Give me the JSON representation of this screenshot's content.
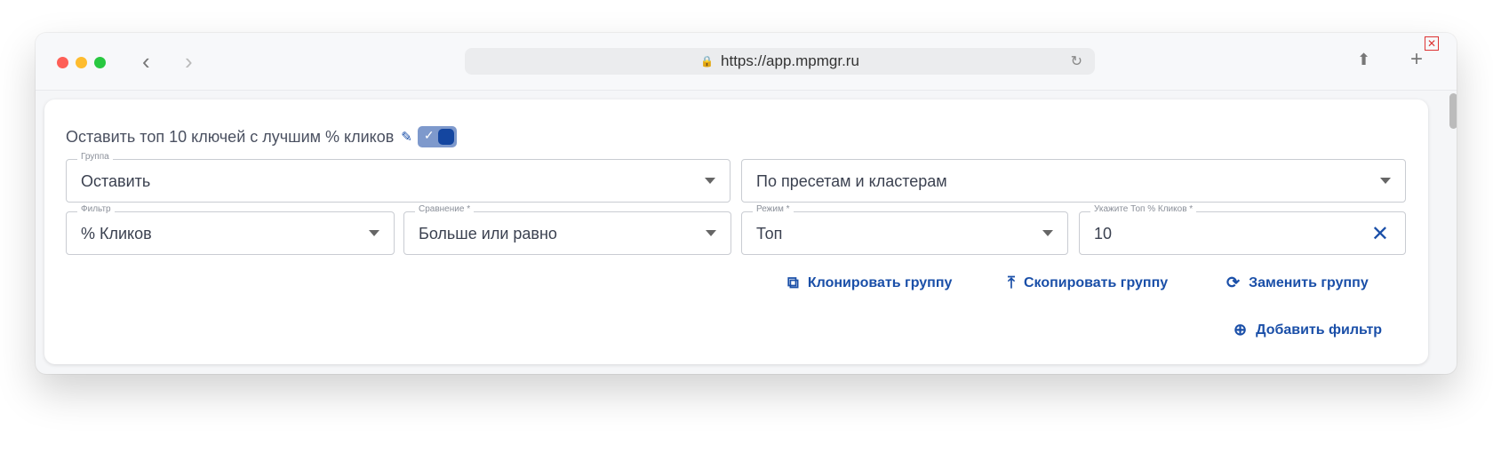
{
  "browser": {
    "url": "https://app.mpmgr.ru"
  },
  "card": {
    "title": "Оставить топ 10 ключей с лучшим % кликов",
    "toggle_on": true,
    "group_field": {
      "label": "Группа",
      "value": "Оставить"
    },
    "mode_field": {
      "value": "По пресетам и кластерам"
    },
    "filter_field": {
      "label": "Фильтр",
      "value": "% Кликов"
    },
    "compare_field": {
      "label": "Сравнение *",
      "value": "Больше или равно"
    },
    "regime_field": {
      "label": "Режим *",
      "value": "Топ"
    },
    "top_field": {
      "label": "Укажите Топ % Кликов *",
      "value": "10"
    },
    "actions": {
      "clone": "Клонировать группу",
      "copy": "Скопировать группу",
      "replace": "Заменить группу",
      "add_filter": "Добавить фильтр"
    }
  },
  "colors": {
    "accent": "#1a4fa8"
  }
}
